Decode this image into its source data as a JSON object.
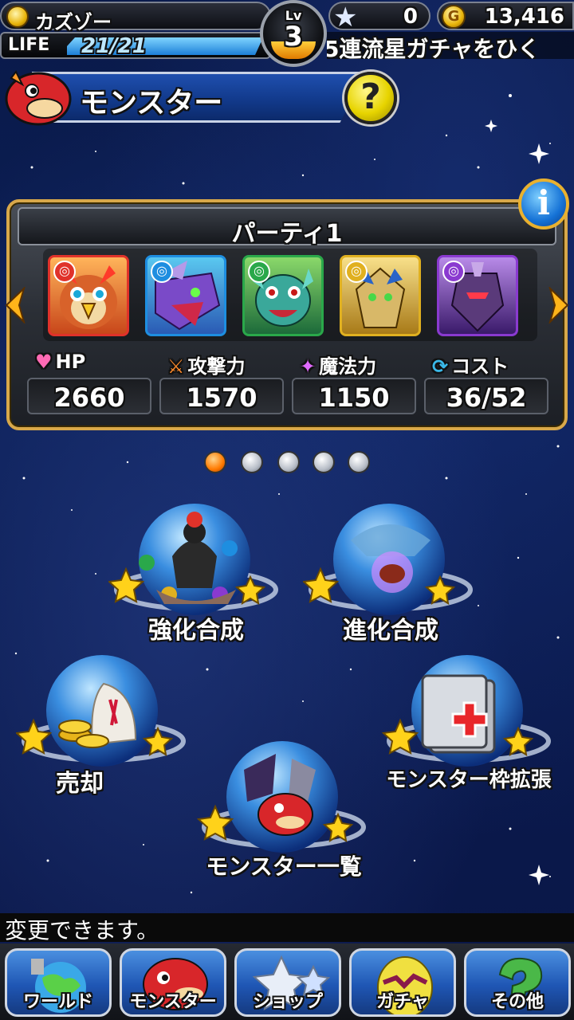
{
  "status": {
    "player_name": "カズゾー",
    "life_label": "LIFE",
    "life_value": "21/21",
    "life_fraction": 1.0,
    "level_label": "Lv",
    "level": "3",
    "stars": "0",
    "gold_icon": "G",
    "gold": "13,416",
    "ticker": "5連流星ガチャをひく"
  },
  "header": {
    "title": "モンスター",
    "help_label": "?"
  },
  "party": {
    "title": "パーティ1",
    "info_label": "i",
    "members": [
      {
        "element": "fire",
        "element_color": "#e0322a",
        "element_glyph": "◎"
      },
      {
        "element": "water",
        "element_color": "#1e8ee0",
        "element_glyph": "◎"
      },
      {
        "element": "wood",
        "element_color": "#2aa84a",
        "element_glyph": "◎"
      },
      {
        "element": "light",
        "element_color": "#e0b020",
        "element_glyph": "◎"
      },
      {
        "element": "dark",
        "element_color": "#8a3ad0",
        "element_glyph": "◎"
      }
    ],
    "stats": {
      "hp_label": "HP",
      "hp_value": "2660",
      "attack_label": "攻撃力",
      "attack_value": "1570",
      "magic_label": "魔法力",
      "magic_value": "1150",
      "cost_label": "コスト",
      "cost_value": "36/52"
    }
  },
  "pager": {
    "count": 5,
    "active_index": 0
  },
  "menu": {
    "power_up": "強化合成",
    "evolve": "進化合成",
    "sell": "売却",
    "expand": "モンスター枠拡張",
    "list": "モンスター一覧"
  },
  "hint_text": "変更できます。",
  "nav": {
    "world": "ワールド",
    "monster": "モンスター",
    "shop": "ショップ",
    "gacha": "ガチャ",
    "other": "その他"
  }
}
